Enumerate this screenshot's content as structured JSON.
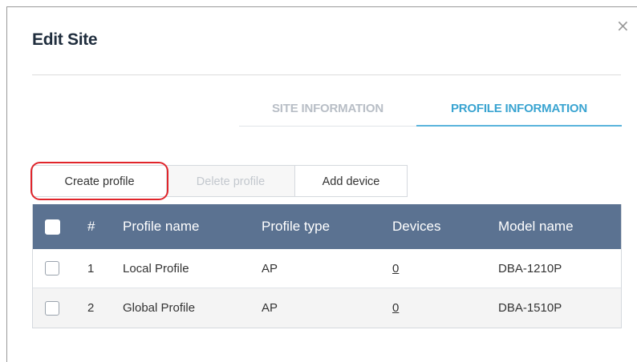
{
  "dialog": {
    "title": "Edit Site",
    "close_glyph": "×"
  },
  "tabs": [
    {
      "label": "SITE INFORMATION",
      "active": false
    },
    {
      "label": "PROFILE INFORMATION",
      "active": true
    }
  ],
  "toolbar": {
    "create_label": "Create profile",
    "delete_label": "Delete profile",
    "add_label": "Add device"
  },
  "table": {
    "headers": {
      "number": "#",
      "profile_name": "Profile name",
      "profile_type": "Profile type",
      "devices": "Devices",
      "model_name": "Model name"
    },
    "rows": [
      {
        "number": "1",
        "profile_name": "Local Profile",
        "profile_type": "AP",
        "devices": "0",
        "model_name": "DBA-1210P"
      },
      {
        "number": "2",
        "profile_name": "Global Profile",
        "profile_type": "AP",
        "devices": "0",
        "model_name": "DBA-1510P"
      }
    ]
  },
  "colors": {
    "header_bg": "#5b7291",
    "active_tab": "#3aa4d1",
    "highlight": "#e0252b"
  }
}
